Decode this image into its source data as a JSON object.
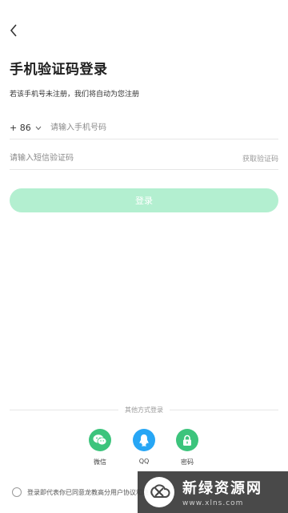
{
  "header": {
    "back_icon": "chevron-left-icon"
  },
  "page": {
    "title": "手机验证码登录",
    "subtitle": "若该手机号未注册，我们将自动为您注册"
  },
  "phone": {
    "country_code": "+ 86",
    "placeholder": "请输入手机号码",
    "value": ""
  },
  "code": {
    "placeholder": "请输入短信验证码",
    "value": "",
    "get_code_label": "获取验证码"
  },
  "login": {
    "label": "登录",
    "color": "#b3efd0",
    "enabled": false
  },
  "other_login": {
    "divider_label": "其他方式登录",
    "options": [
      {
        "label": "微信",
        "icon": "wechat-icon",
        "color": "#3cc47c"
      },
      {
        "label": "QQ",
        "icon": "qq-icon",
        "color": "#27a6f5"
      },
      {
        "label": "密码",
        "icon": "lock-icon",
        "color": "#3cc47c"
      }
    ]
  },
  "agreement": {
    "checked": false,
    "text": "登录即代表你已同意龙教高分用户",
    "link": "协议和隐私政策"
  },
  "watermark": {
    "main": "新绿资源网",
    "url": "www.xlns.com"
  }
}
